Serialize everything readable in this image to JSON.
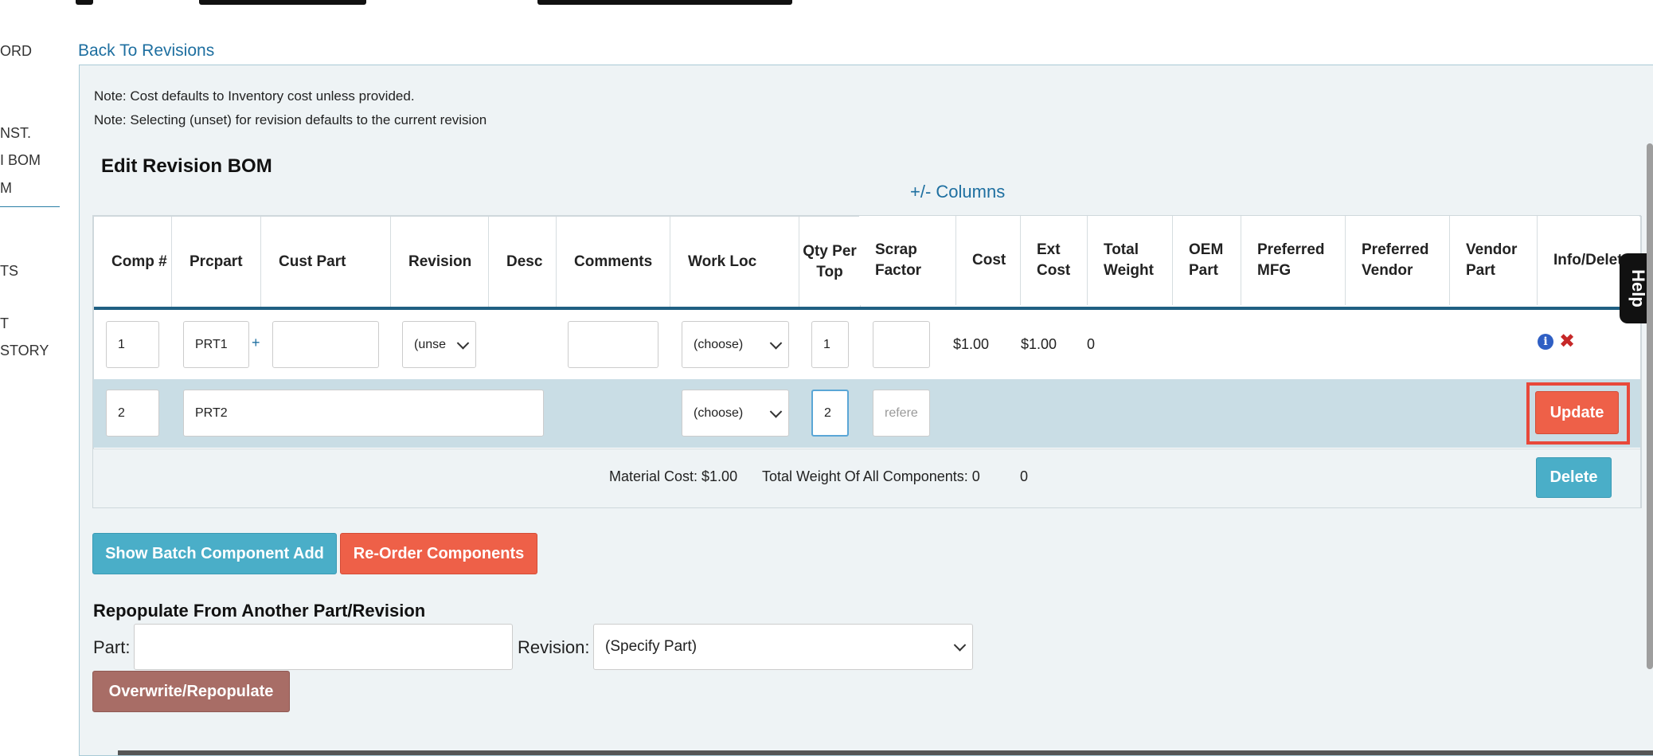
{
  "left_nav": {
    "items": [
      "ORD",
      "NST.",
      "I BOM",
      "M",
      "TS",
      "T",
      "STORY"
    ]
  },
  "back_link": "Back To Revisions",
  "notes": [
    "Note: Cost defaults to Inventory cost unless provided.",
    "Note: Selecting (unset) for revision defaults to the current revision"
  ],
  "section_title": "Edit Revision BOM",
  "columns_toggle": "+/- Columns",
  "table": {
    "headers": [
      "Comp #",
      "Prcpart",
      "Cust Part",
      "Revision",
      "Desc",
      "Comments",
      "Work Loc",
      "Qty Per Top",
      "Scrap Factor",
      "Cost",
      "Ext Cost",
      "Total Weight",
      "OEM Part",
      "Preferred MFG",
      "Preferred Vendor",
      "Vendor Part",
      "Info/Delete"
    ],
    "row1": {
      "comp": "1",
      "prcpart": "PRT1",
      "plus": "+",
      "cust_part": "",
      "revision": "(unse",
      "comments": "",
      "work_loc": "(choose)",
      "qty": "1",
      "scrap": "",
      "cost": "$1.00",
      "ext_cost": "$1.00",
      "total_weight": "0"
    },
    "row2": {
      "comp": "2",
      "prcpart": "PRT2",
      "work_loc": "(choose)",
      "qty": "2",
      "scrap_placeholder": "refere",
      "update_label": "Update"
    },
    "footer": {
      "material_cost": "Material Cost: $1.00",
      "total_weight": "Total Weight Of All Components: 0",
      "extra_zero": "0",
      "delete_label": "Delete"
    }
  },
  "actions": {
    "batch_add": "Show Batch Component Add",
    "reorder": "Re-Order Components"
  },
  "repopulate": {
    "title": "Repopulate From Another Part/Revision",
    "part_label": "Part:",
    "part_value": "",
    "revision_label": "Revision:",
    "revision_value": "(Specify Part)",
    "button": "Overwrite/Repopulate"
  },
  "help_tab": "Help",
  "colors": {
    "accent_orange": "#ee6048",
    "accent_teal": "#4aaec8",
    "link_blue": "#1e6fa0",
    "header_rule": "#1f5f82"
  }
}
